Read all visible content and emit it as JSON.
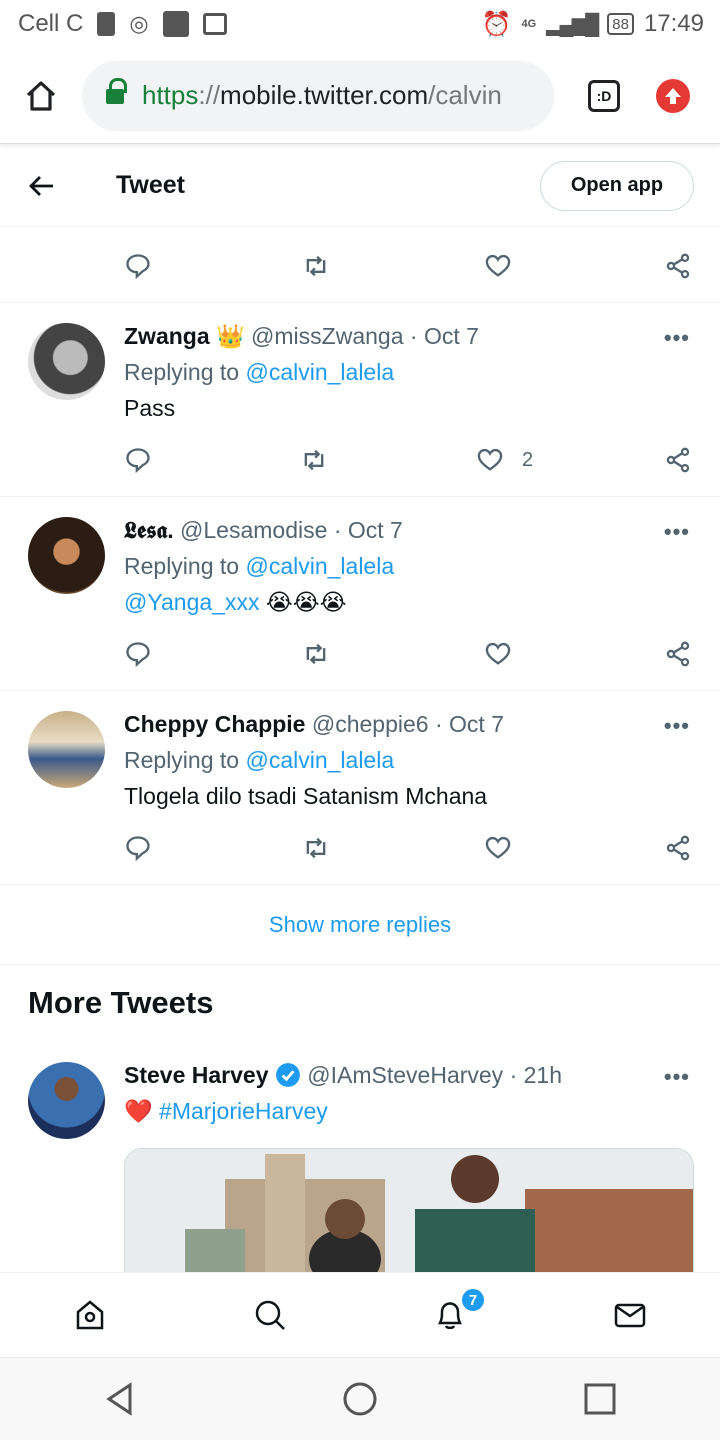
{
  "status_bar": {
    "carrier": "Cell C",
    "network": "4G",
    "battery": "88",
    "time": "17:49"
  },
  "browser": {
    "url_scheme": "https",
    "url_sep": "://",
    "url_host": "mobile.twitter.com",
    "url_path": "/calvin",
    "tabs_label": ":D",
    "accent": "#188038"
  },
  "header": {
    "title": "Tweet",
    "open_app": "Open app"
  },
  "replies": [
    {
      "name": "Zwanga",
      "emoji": "👑",
      "handle": "@missZwanga",
      "date": "Oct 7",
      "replying_label": "Replying to",
      "replying_to": "@calvin_lalela",
      "text": "Pass",
      "likes": "2"
    },
    {
      "name": "𝕷𝖊𝖘𝖆.",
      "handle": "@Lesamodise",
      "date": "Oct 7",
      "replying_label": "Replying to",
      "replying_to": "@calvin_lalela",
      "text_mention": "@Yanga_xxx",
      "text_emoji": "😭😭😭",
      "likes": ""
    },
    {
      "name": "Cheppy Chappie",
      "handle": "@cheppie6",
      "date": "Oct 7",
      "replying_label": "Replying to",
      "replying_to": "@calvin_lalela",
      "text": "Tlogela dilo tsadi Satanism Mchana",
      "likes": ""
    }
  ],
  "show_more": "Show more replies",
  "more_tweets": {
    "title": "More Tweets",
    "tweet": {
      "name": "Steve Harvey",
      "handle": "@IAmSteveHarvey",
      "time": "21h",
      "heart": "❤️",
      "hashtag": "#MarjorieHarvey"
    }
  },
  "sep": "·",
  "more_dots": "•••",
  "bottom_nav": {
    "notifications_badge": "7"
  },
  "colors": {
    "link": "#1d9bf0",
    "muted": "#536471",
    "badge": "#1d9bf0",
    "verified": "#1d9bf0"
  }
}
